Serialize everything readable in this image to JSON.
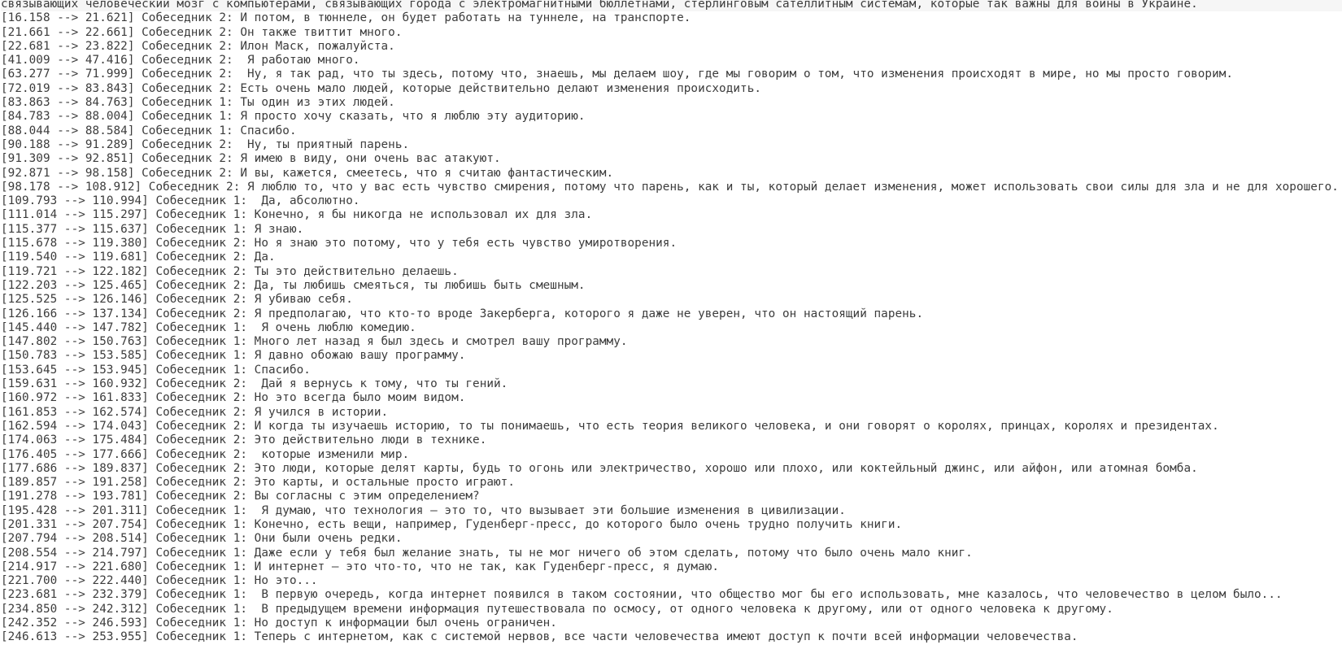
{
  "terminal": {
    "lines": [
      "связывающих человеческий мозг с компьютерами, связывающих города с электромагнитными бюллетнами, стерлинговым сателлитным системам, которые так важны для войны в Украине.",
      "[16.158 --> 21.621] Собеседник 2: И потом, в тюннеле, он будет работать на туннеле, на транспорте.",
      "[21.661 --> 22.661] Собеседник 2: Он также твиттит много.",
      "[22.681 --> 23.822] Собеседник 2: Илон Маск, пожалуйста.",
      "[41.009 --> 47.416] Собеседник 2:  Я работаю много.",
      "[63.277 --> 71.999] Собеседник 2:  Ну, я так рад, что ты здесь, потому что, знаешь, мы делаем шоу, где мы говорим о том, что изменения происходят в мире, но мы просто говорим.",
      "[72.019 --> 83.843] Собеседник 2: Есть очень мало людей, которые действительно делают изменения происходить.",
      "[83.863 --> 84.763] Собеседник 1: Ты один из этих людей.",
      "[84.783 --> 88.004] Собеседник 1: Я просто хочу сказать, что я люблю эту аудиторию.",
      "[88.044 --> 88.584] Собеседник 1: Спасибо.",
      "[90.188 --> 91.289] Собеседник 2:  Ну, ты приятный парень.",
      "[91.309 --> 92.851] Собеседник 2: Я имею в виду, они очень вас атакуют.",
      "[92.871 --> 98.158] Собеседник 2: И вы, кажется, смеетесь, что я считаю фантастическим.",
      "[98.178 --> 108.912] Собеседник 2: Я люблю то, что у вас есть чувство смирения, потому что парень, как и ты, который делает изменения, может использовать свои силы для зла и не для хорошего.",
      "[109.793 --> 110.994] Собеседник 1:  Да, абсолютно.",
      "[111.014 --> 115.297] Собеседник 1: Конечно, я бы никогда не использовал их для зла.",
      "[115.377 --> 115.637] Собеседник 1: Я знаю.",
      "[115.678 --> 119.380] Собеседник 2: Но я знаю это потому, что у тебя есть чувство умиротворения.",
      "[119.540 --> 119.681] Собеседник 2: Да.",
      "[119.721 --> 122.182] Собеседник 2: Ты это действительно делаешь.",
      "[122.203 --> 125.465] Собеседник 2: Да, ты любишь смеяться, ты любишь быть смешным.",
      "[125.525 --> 126.146] Собеседник 2: Я убиваю себя.",
      "[126.166 --> 137.134] Собеседник 2: Я предполагаю, что кто-то вроде Закерберга, которого я даже не уверен, что он настоящий парень.",
      "[145.440 --> 147.782] Собеседник 1:  Я очень люблю комедию.",
      "[147.802 --> 150.763] Собеседник 1: Много лет назад я был здесь и смотрел вашу программу.",
      "[150.783 --> 153.585] Собеседник 1: Я давно обожаю вашу программу.",
      "[153.645 --> 153.945] Собеседник 1: Спасибо.",
      "[159.631 --> 160.932] Собеседник 2:  Дай я вернусь к тому, что ты гений.",
      "[160.972 --> 161.833] Собеседник 2: Но это всегда было моим видом.",
      "[161.853 --> 162.574] Собеседник 2: Я учился в истории.",
      "[162.594 --> 174.043] Собеседник 2: И когда ты изучаешь историю, то ты понимаешь, что есть теория великого человека, и они говорят о королях, принцах, королях и президентах.",
      "[174.063 --> 175.484] Собеседник 2: Это действительно люди в технике.",
      "[176.405 --> 177.666] Собеседник 2:  которые изменили мир.",
      "[177.686 --> 189.837] Собеседник 2: Это люди, которые делят карты, будь то огонь или электричество, хорошо или плохо, или коктейльный джинс, или айфон, или атомная бомба.",
      "[189.857 --> 191.258] Собеседник 2: Это карты, и остальные просто играют.",
      "[191.278 --> 193.781] Собеседник 2: Вы согласны с этим определением?",
      "[195.428 --> 201.311] Собеседник 1:  Я думаю, что технология — это то, что вызывает эти большие изменения в цивилизации.",
      "[201.331 --> 207.754] Собеседник 1: Конечно, есть вещи, например, Гуденберг-пресс, до которого было очень трудно получить книги.",
      "[207.794 --> 208.514] Собеседник 1: Они были очень редки.",
      "[208.554 --> 214.797] Собеседник 1: Даже если у тебя был желание знать, ты не мог ничего об этом сделать, потому что было очень мало книг.",
      "[214.917 --> 221.680] Собеседник 1: И интернет — это что-то, что не так, как Гуденберг-пресс, я думаю.",
      "[221.700 --> 222.440] Собеседник 1: Но это...",
      "[223.681 --> 232.379] Собеседник 1:  В первую очередь, когда интернет появился в таком состоянии, что общество мог бы его использовать, мне казалось, что человечество в целом было...",
      "[234.850 --> 242.312] Собеседник 1:  В предыдущем времени информация путешествовала по осмосу, от одного человека к другому, или от одного человека к другому.",
      "[242.352 --> 246.593] Собеседник 1: Но доступ к информации был очень ограничен.",
      "[246.613 --> 253.955] Собеседник 1: Теперь с интернетом, как с системой нервов, все части человечества имеют доступ к почти всей информации человечества."
    ]
  }
}
